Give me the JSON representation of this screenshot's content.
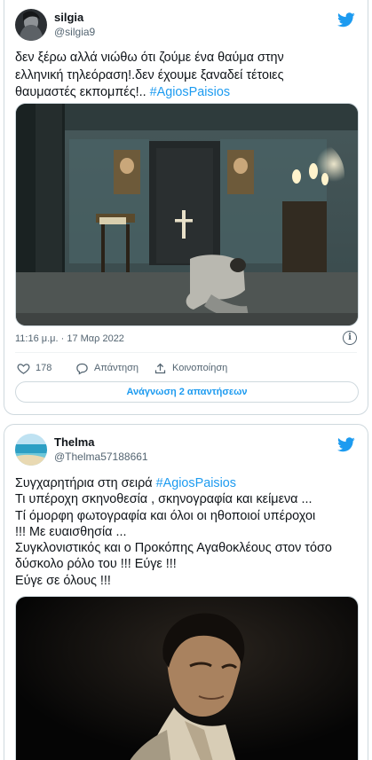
{
  "tweets": [
    {
      "user_name": "silgia",
      "user_handle": "@silgia9",
      "avatar_icon": "avatar-dark-portrait",
      "text_line1": "δεν ξέρω αλλά νιώθω ότι ζούμε ένα θαύμα στην",
      "text_line2": "ελληνική τηλεόραση!.δεν έχουμε ξαναδεί τέτοιες",
      "text_line3_prefix": "θαυμαστές εκπομπές!..  ",
      "hashtag": "#AgiosPaisios",
      "timestamp": "11:16 μ.μ. · 17 Μαρ 2022",
      "likes": "178",
      "reply_label": "Απάντηση",
      "share_label": "Κοινοποίηση",
      "read_replies_label": "Ανάγνωση 2 απαντήσεων"
    },
    {
      "user_name": "Thelma",
      "user_handle": "@Thelma57188661",
      "avatar_icon": "avatar-seascape",
      "line1_prefix": "Συγχαρητήρια στη σειρά ",
      "hashtag": "#AgiosPaisios",
      "line2": "Τι υπέροχη σκηνοθεσία , σκηνογραφία και κείμενα ...",
      "line3": "Τί όμορφη φωτογραφία και όλοι οι ηθοποιοί υπέροχοι",
      "line4": "!!! Με ευαισθησία ...",
      "line5": "Συγκλονιστικός και ο Προκόπης Αγαθοκλέους στον τόσο",
      "line6": "δύσκολο ρόλο του !!! Εύγε !!!",
      "line7": "Εύγε σε όλους !!!"
    }
  ],
  "colors": {
    "accent": "#1d9bf0",
    "text": "#0f1419",
    "muted": "#536471",
    "border": "#cfd9de"
  }
}
